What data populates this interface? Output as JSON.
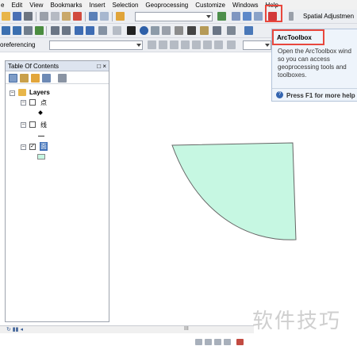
{
  "menu": [
    "e",
    "Edit",
    "View",
    "Bookmarks",
    "Insert",
    "Selection",
    "Geoprocessing",
    "Customize",
    "Windows",
    "Help"
  ],
  "toolbar1": {
    "spatial_adjustment": "Spatial Adjustmen"
  },
  "toolbar3": {
    "georeferencing": "oreferencing"
  },
  "toc": {
    "title": "Table Of Contents",
    "controls": "□ ×",
    "root_label": "Layers",
    "layers": [
      {
        "name": "点",
        "checked": false,
        "symbol": "point"
      },
      {
        "name": "线",
        "checked": false,
        "symbol": "line"
      },
      {
        "name": "面",
        "checked": true,
        "symbol": "polygon"
      }
    ]
  },
  "tooltip": {
    "title": "ArcToolbox",
    "body": "Open the ArcToolbox wind so you can access geoprocessing tools and toolboxes.",
    "footer": "Press F1 for more help"
  },
  "map": {
    "polygon_fill": "#c6f7e2",
    "polygon_stroke": "#666666"
  },
  "status": {
    "scroll_mark": "III"
  },
  "watermark": "软件技巧",
  "colors": {
    "highlight": "#e8473d",
    "panel_header": "#dde4ef"
  }
}
